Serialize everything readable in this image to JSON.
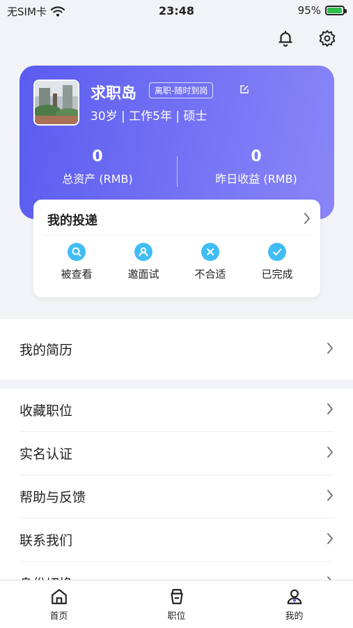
{
  "status": {
    "carrier": "无SIM卡",
    "time": "23:48",
    "battery": "95%",
    "battery_level": 0.95
  },
  "header": {
    "icons": [
      "bell-icon",
      "gear-icon"
    ]
  },
  "profile": {
    "name": "求职岛",
    "job_status": "离职-随时到岗",
    "meta": "30岁 | 工作5年 | 硕士",
    "stats": [
      {
        "value": "0",
        "label": "总资产 (RMB)"
      },
      {
        "value": "0",
        "label": "昨日收益 (RMB)"
      }
    ],
    "gradient": [
      "#5a5cf0",
      "#8a86f8"
    ]
  },
  "delivery": {
    "title": "我的投递",
    "items": [
      {
        "label": "被查看",
        "icon": "search-icon"
      },
      {
        "label": "邀面试",
        "icon": "person-icon"
      },
      {
        "label": "不合适",
        "icon": "close-icon"
      },
      {
        "label": "已完成",
        "icon": "check-icon"
      }
    ],
    "accent": "#41bdf6"
  },
  "menu": {
    "resume": "我的简历",
    "items": [
      "收藏职位",
      "实名认证",
      "帮助与反馈",
      "联系我们",
      "身份切换"
    ]
  },
  "tabbar": {
    "tabs": [
      {
        "label": "首页",
        "icon": "home-icon"
      },
      {
        "label": "职位",
        "icon": "briefcase-icon"
      },
      {
        "label": "我的",
        "icon": "user-icon"
      }
    ]
  }
}
